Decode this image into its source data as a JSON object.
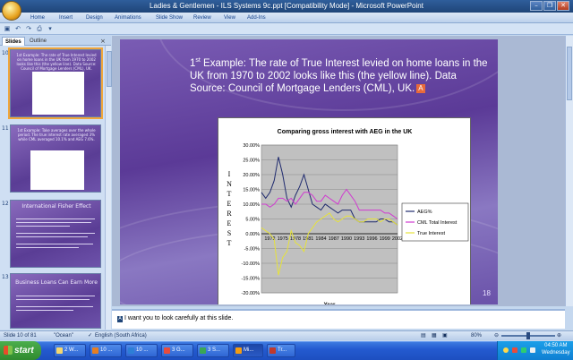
{
  "window": {
    "title": "Ladies & Gentlemen - ILS Systems 9c.ppt [Compatibility Mode] - Microsoft PowerPoint",
    "controls": [
      "–",
      "❐",
      "✕"
    ]
  },
  "ribbon": {
    "tabs": [
      "Home",
      "Insert",
      "Design",
      "Animations",
      "Slide Show",
      "Review",
      "View",
      "Add-Ins"
    ]
  },
  "pane": {
    "tabs": [
      "Slides",
      "Outline"
    ],
    "close": "×",
    "thumbs": [
      {
        "num": "10",
        "title": "1st Example: The rate of True Interest levied on home loans in the UK from 1970 to 2002 looks like this (the yellow line). Data Source: Council of Mortgage Lenders (CML), UK."
      },
      {
        "num": "11",
        "title": "1st Example: Take averages over the whole period. The true interest rate averaged 3% while CML averaged 10.1% and AEG 7.6%."
      },
      {
        "num": "12",
        "title": "International Fisher Effect"
      },
      {
        "num": "13",
        "title": "Business Loans Can Earn More"
      }
    ]
  },
  "slide": {
    "title_prefix": "1",
    "title_sup": "st",
    "title_rest": " Example: The rate of True Interest levied on home loans in the UK from 1970 to 2002 looks like this (the yellow line). Data Source: Council of Mortgage Lenders (CML), UK.",
    "anim_marker": "A",
    "number": "18"
  },
  "notes": {
    "marker": "A",
    "text": "I want you to look carefully at this slide."
  },
  "status": {
    "slide_of": "Slide 10 of 81",
    "theme": "\"Ocean\"",
    "language": "English (South Africa)",
    "zoom": "80%"
  },
  "taskbar": {
    "start": "start",
    "tasks": [
      "2 W...",
      "10 ...",
      "10 ...",
      "3 G...",
      "3 S...",
      "Mi...",
      "Tr..."
    ],
    "time": "04:50 AM",
    "day": "Wednesday"
  },
  "chart_data": {
    "type": "line",
    "title": "Comparing gross interest with AEG in the UK",
    "xlabel": "Year",
    "ylabel": "INTEREST",
    "ylim": [
      -0.2,
      0.3
    ],
    "yticks": [
      "30.00%",
      "25.00%",
      "20.00%",
      "15.00%",
      "10.00%",
      "5.00%",
      "0.00%",
      "-5.00%",
      "-10.00%",
      "-15.00%",
      "-20.00%"
    ],
    "xticklabels": [
      "1972",
      "1975",
      "1978",
      "1981",
      "1984",
      "1987",
      "1990",
      "1993",
      "1996",
      "1999",
      "2002"
    ],
    "x": [
      1970,
      1971,
      1972,
      1973,
      1974,
      1975,
      1976,
      1977,
      1978,
      1979,
      1980,
      1981,
      1982,
      1983,
      1984,
      1985,
      1986,
      1987,
      1988,
      1989,
      1990,
      1991,
      1992,
      1993,
      1994,
      1995,
      1996,
      1997,
      1998,
      1999,
      2000,
      2001,
      2002
    ],
    "series": [
      {
        "name": "AEG%",
        "color": "#1f2a6e",
        "values": [
          0.14,
          0.12,
          0.14,
          0.18,
          0.26,
          0.2,
          0.12,
          0.09,
          0.13,
          0.16,
          0.2,
          0.15,
          0.1,
          0.09,
          0.08,
          0.1,
          0.09,
          0.08,
          0.07,
          0.08,
          0.08,
          0.08,
          0.05,
          0.04,
          0.04,
          0.04,
          0.04,
          0.04,
          0.05,
          0.05,
          0.04,
          0.04,
          0.03
        ]
      },
      {
        "name": "CML Total Interest",
        "color": "#d03ad0",
        "values": [
          0.1,
          0.1,
          0.09,
          0.1,
          0.12,
          0.12,
          0.11,
          0.12,
          0.1,
          0.12,
          0.14,
          0.14,
          0.13,
          0.11,
          0.11,
          0.13,
          0.12,
          0.11,
          0.1,
          0.13,
          0.15,
          0.13,
          0.11,
          0.08,
          0.08,
          0.08,
          0.08,
          0.08,
          0.08,
          0.07,
          0.07,
          0.06,
          0.05
        ]
      },
      {
        "name": "True Interest",
        "color": "#e6e23a",
        "values": [
          0.02,
          0.01,
          0.0,
          -0.02,
          -0.14,
          -0.08,
          -0.06,
          0.01,
          -0.03,
          -0.04,
          -0.06,
          0.0,
          0.02,
          0.04,
          0.05,
          0.06,
          0.07,
          0.05,
          0.04,
          0.05,
          0.06,
          0.06,
          0.05,
          0.04,
          0.04,
          0.05,
          0.05,
          0.05,
          0.04,
          0.05,
          0.05,
          0.04,
          0.03
        ]
      }
    ],
    "legend_position": "right",
    "grid": true,
    "plot_background": "#c0c0c0"
  }
}
